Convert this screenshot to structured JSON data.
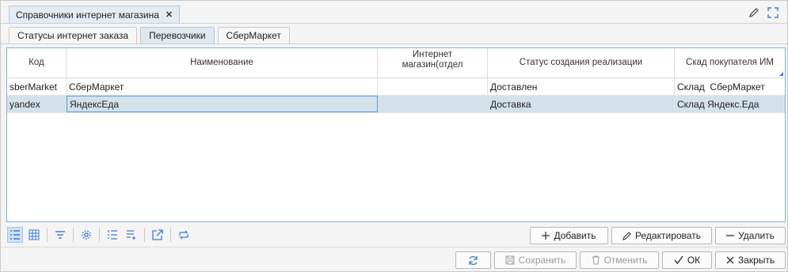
{
  "window": {
    "tab_title": "Справочники интернет магазина",
    "close_glyph": "✕"
  },
  "tabs": [
    {
      "label": "Статусы интернет заказа",
      "active": false
    },
    {
      "label": "Перевозчики",
      "active": true
    },
    {
      "label": "СберМаркет",
      "active": false
    }
  ],
  "grid": {
    "columns": [
      "Код",
      "Наименование",
      "Интернет магазин(отдел",
      "Статус создания реализации",
      "Скад покупателя ИМ"
    ],
    "rows": [
      [
        "sberMarket",
        "СберМаркет",
        "",
        "Доставлен",
        "Склад  СберМаркет"
      ],
      [
        "yandex",
        "ЯндексЕда",
        "",
        "Доставка",
        "Склад Яндекс.Еда"
      ]
    ],
    "selected_row": 1
  },
  "actions": {
    "add": "Добавить",
    "edit": "Редактировать",
    "delete": "Удалить"
  },
  "footer": {
    "save": "Сохранить",
    "cancel": "Отменить",
    "ok": "ОК",
    "close": "Закрыть"
  },
  "colors": {
    "accent": "#3a7bd5",
    "selected_row": "#d3e2ea",
    "active_tab": "#dfe7ef"
  },
  "icons": [
    "pencil-icon",
    "fullscreen-icon",
    "list-view-icon",
    "grid-view-icon",
    "filter-icon",
    "settings-icon",
    "numbered-list-icon",
    "add-rows-icon",
    "export-icon",
    "transfer-icon",
    "refresh-icon",
    "save-icon",
    "trash-icon",
    "check-icon",
    "close-icon"
  ]
}
